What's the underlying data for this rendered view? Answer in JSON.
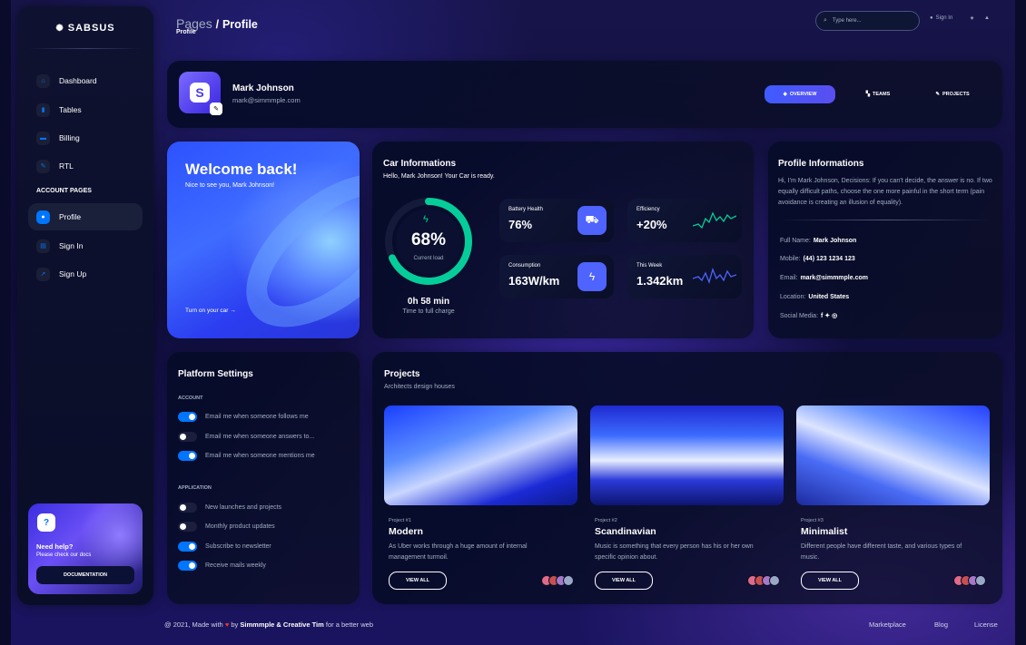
{
  "brand": {
    "name": "SABSUS"
  },
  "sidebar": {
    "items": [
      {
        "label": "Dashboard",
        "icon": "home-icon"
      },
      {
        "label": "Tables",
        "icon": "chart-icon"
      },
      {
        "label": "Billing",
        "icon": "card-icon"
      },
      {
        "label": "RTL",
        "icon": "wrench-icon"
      }
    ],
    "section": "ACCOUNT PAGES",
    "account_items": [
      {
        "label": "Profile",
        "icon": "user-icon",
        "active": true
      },
      {
        "label": "Sign In",
        "icon": "document-icon"
      },
      {
        "label": "Sign Up",
        "icon": "rocket-icon"
      }
    ],
    "help": {
      "icon": "?",
      "title": "Need help?",
      "subtitle": "Please check our docs",
      "button": "DOCUMENTATION"
    }
  },
  "topbar": {
    "crumb_parent": "Pages",
    "crumb_sep": "/",
    "crumb_current": "Profile",
    "subtitle": "Profile",
    "search_placeholder": "Type here...",
    "signin": "Sign In"
  },
  "header": {
    "avatar_letter": "S",
    "name": "Mark Johnson",
    "email": "mark@simmmple.com",
    "tabs": [
      {
        "label": "OVERVIEW",
        "icon": "◆",
        "active": true
      },
      {
        "label": "TEAMS",
        "icon": "▚"
      },
      {
        "label": "PROJECTS",
        "icon": "✎"
      }
    ]
  },
  "welcome": {
    "title": "Welcome back!",
    "subtitle": "Nice to see you, Mark Johnson!",
    "link": "Turn on your car →"
  },
  "car": {
    "title": "Car Informations",
    "subtitle": "Hello, Mark Johnson! Your Car is ready.",
    "gauge_percent": 68,
    "gauge_value": "68%",
    "gauge_label": "Current load",
    "time": "0h 58 min",
    "time_label": "Time to full charge",
    "stats": [
      {
        "label": "Battery Health",
        "value": "76%"
      },
      {
        "label": "Efficiency",
        "value": "+20%"
      },
      {
        "label": "Consumption",
        "value": "163W/km"
      },
      {
        "label": "This Week",
        "value": "1.342km"
      }
    ],
    "colors": {
      "gauge": "#05cd99",
      "accent": "#4f63ff"
    }
  },
  "profile_info": {
    "title": "Profile Informations",
    "description": "Hi, I’m Mark Johnson, Decisions: If you can’t decide, the answer is no. If two equally difficult paths, choose the one more painful in the short term (pain avoidance is creating an illusion of equality).",
    "rows": [
      {
        "label": "Full Name:",
        "value": "Mark Johnson"
      },
      {
        "label": "Mobile:",
        "value": "(44) 123 1234 123"
      },
      {
        "label": "Email:",
        "value": "mark@simmmple.com"
      },
      {
        "label": "Location:",
        "value": "United States"
      },
      {
        "label": "Social Media:",
        "value": "f  ✦  ◎"
      }
    ]
  },
  "settings": {
    "title": "Platform Settings",
    "section_account": "ACCOUNT",
    "section_app": "APPLICATION",
    "account": [
      {
        "label": "Email me when someone follows me",
        "on": true
      },
      {
        "label": "Email me when someone answers to...",
        "on": false
      },
      {
        "label": "Email me when someone mentions me",
        "on": true
      }
    ],
    "application": [
      {
        "label": "New launches and projects",
        "on": false
      },
      {
        "label": "Monthly product updates",
        "on": false
      },
      {
        "label": "Subscribe to newsletter",
        "on": true
      },
      {
        "label": "Receive mails weekly",
        "on": true
      }
    ]
  },
  "projects": {
    "title": "Projects",
    "subtitle": "Architects design houses",
    "items": [
      {
        "num": "Project #1",
        "name": "Modern",
        "desc": "As Uber works through a huge amount of internal management turmoil.",
        "button": "VIEW ALL"
      },
      {
        "num": "Project #2",
        "name": "Scandinavian",
        "desc": "Music is something that every person has his or her own specific opinion about.",
        "button": "VIEW ALL"
      },
      {
        "num": "Project #3",
        "name": "Minimalist",
        "desc": "Different people have different taste, and various types of music.",
        "button": "VIEW ALL"
      }
    ]
  },
  "footer": {
    "prefix": "@ 2021, Made with",
    "heart": "♥",
    "by": "by",
    "authors": "Simmmple & Creative Tim",
    "suffix": "for a better web",
    "links": [
      "Marketplace",
      "Blog",
      "License"
    ]
  }
}
